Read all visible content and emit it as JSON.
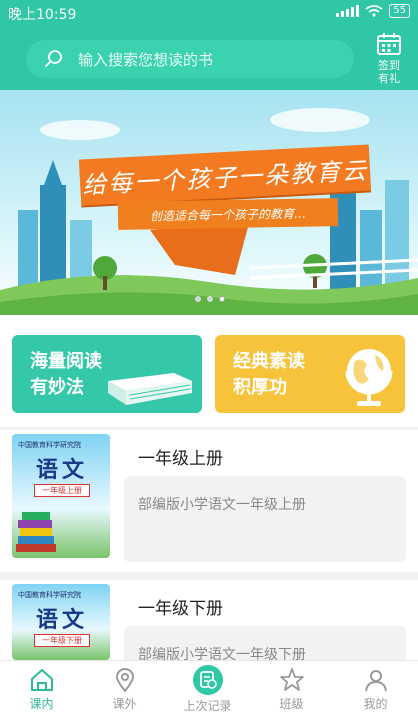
{
  "status_bar": {
    "time": "晚上10:59",
    "battery": "55"
  },
  "search": {
    "placeholder": "输入搜索您想读的书"
  },
  "checkin": {
    "line1": "签到",
    "line2": "有礼"
  },
  "banner": {
    "slogan": "给每一个孩子一朵教育云",
    "subslogan": "创造适合每一个孩子的教育…",
    "slide_count": 3,
    "active_slide": 3
  },
  "features": [
    {
      "line1": "海量阅读",
      "line2": "有妙法",
      "icon": "book-icon",
      "color": "#34c8a8"
    },
    {
      "line1": "经典素读",
      "line2": "积厚功",
      "icon": "globe-icon",
      "color": "#f7c33b"
    }
  ],
  "books": [
    {
      "title": "一年级上册",
      "desc": "部编版小学语文一年级上册",
      "cover_subject": "语文",
      "cover_grade": "一年级上册",
      "cover_publisher": "中国教育科学研究院"
    },
    {
      "title": "一年级下册",
      "desc": "部编版小学语文一年级下册",
      "cover_subject": "语文",
      "cover_grade": "一年级下册",
      "cover_publisher": "中国教育科学研究院"
    }
  ],
  "tabs": [
    {
      "label": "课内",
      "icon": "home-icon",
      "active": true
    },
    {
      "label": "课外",
      "icon": "location-icon",
      "active": false
    },
    {
      "label": "上次记录",
      "icon": "history-icon",
      "active": false
    },
    {
      "label": "班级",
      "icon": "star-icon",
      "active": false
    },
    {
      "label": "我的",
      "icon": "user-icon",
      "active": false
    }
  ],
  "colors": {
    "primary": "#2fc7a5",
    "orange": "#f47a21",
    "yellow": "#f7c33b"
  }
}
